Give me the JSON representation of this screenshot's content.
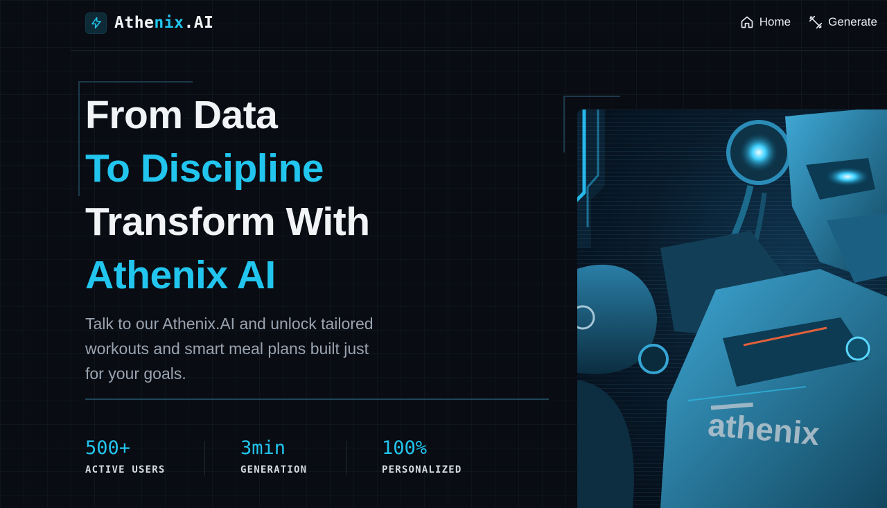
{
  "header": {
    "logo_part1": "Athe",
    "logo_part2": "nix",
    "logo_part3": ".AI",
    "logo_icon": "lightning-icon",
    "nav": [
      {
        "label": "Home",
        "icon": "home-icon"
      },
      {
        "label": "Generate",
        "icon": "dumbbell-icon"
      }
    ]
  },
  "hero": {
    "headline": [
      "From Data",
      "To Discipline",
      "Transform With",
      "Athenix AI"
    ],
    "subtitle": "Talk to our Athenix.AI and unlock tailored workouts and smart meal plans built just for your goals.",
    "stats": [
      {
        "value": "500+",
        "label": "ACTIVE USERS"
      },
      {
        "value": "3min",
        "label": "GENERATION"
      },
      {
        "value": "100%",
        "label": "PERSONALIZED"
      }
    ],
    "image_text": "athenix"
  },
  "colors": {
    "accent": "#22c5ee",
    "background": "#090c12",
    "text": "#f1f3f6",
    "muted": "#9aa4b1"
  }
}
